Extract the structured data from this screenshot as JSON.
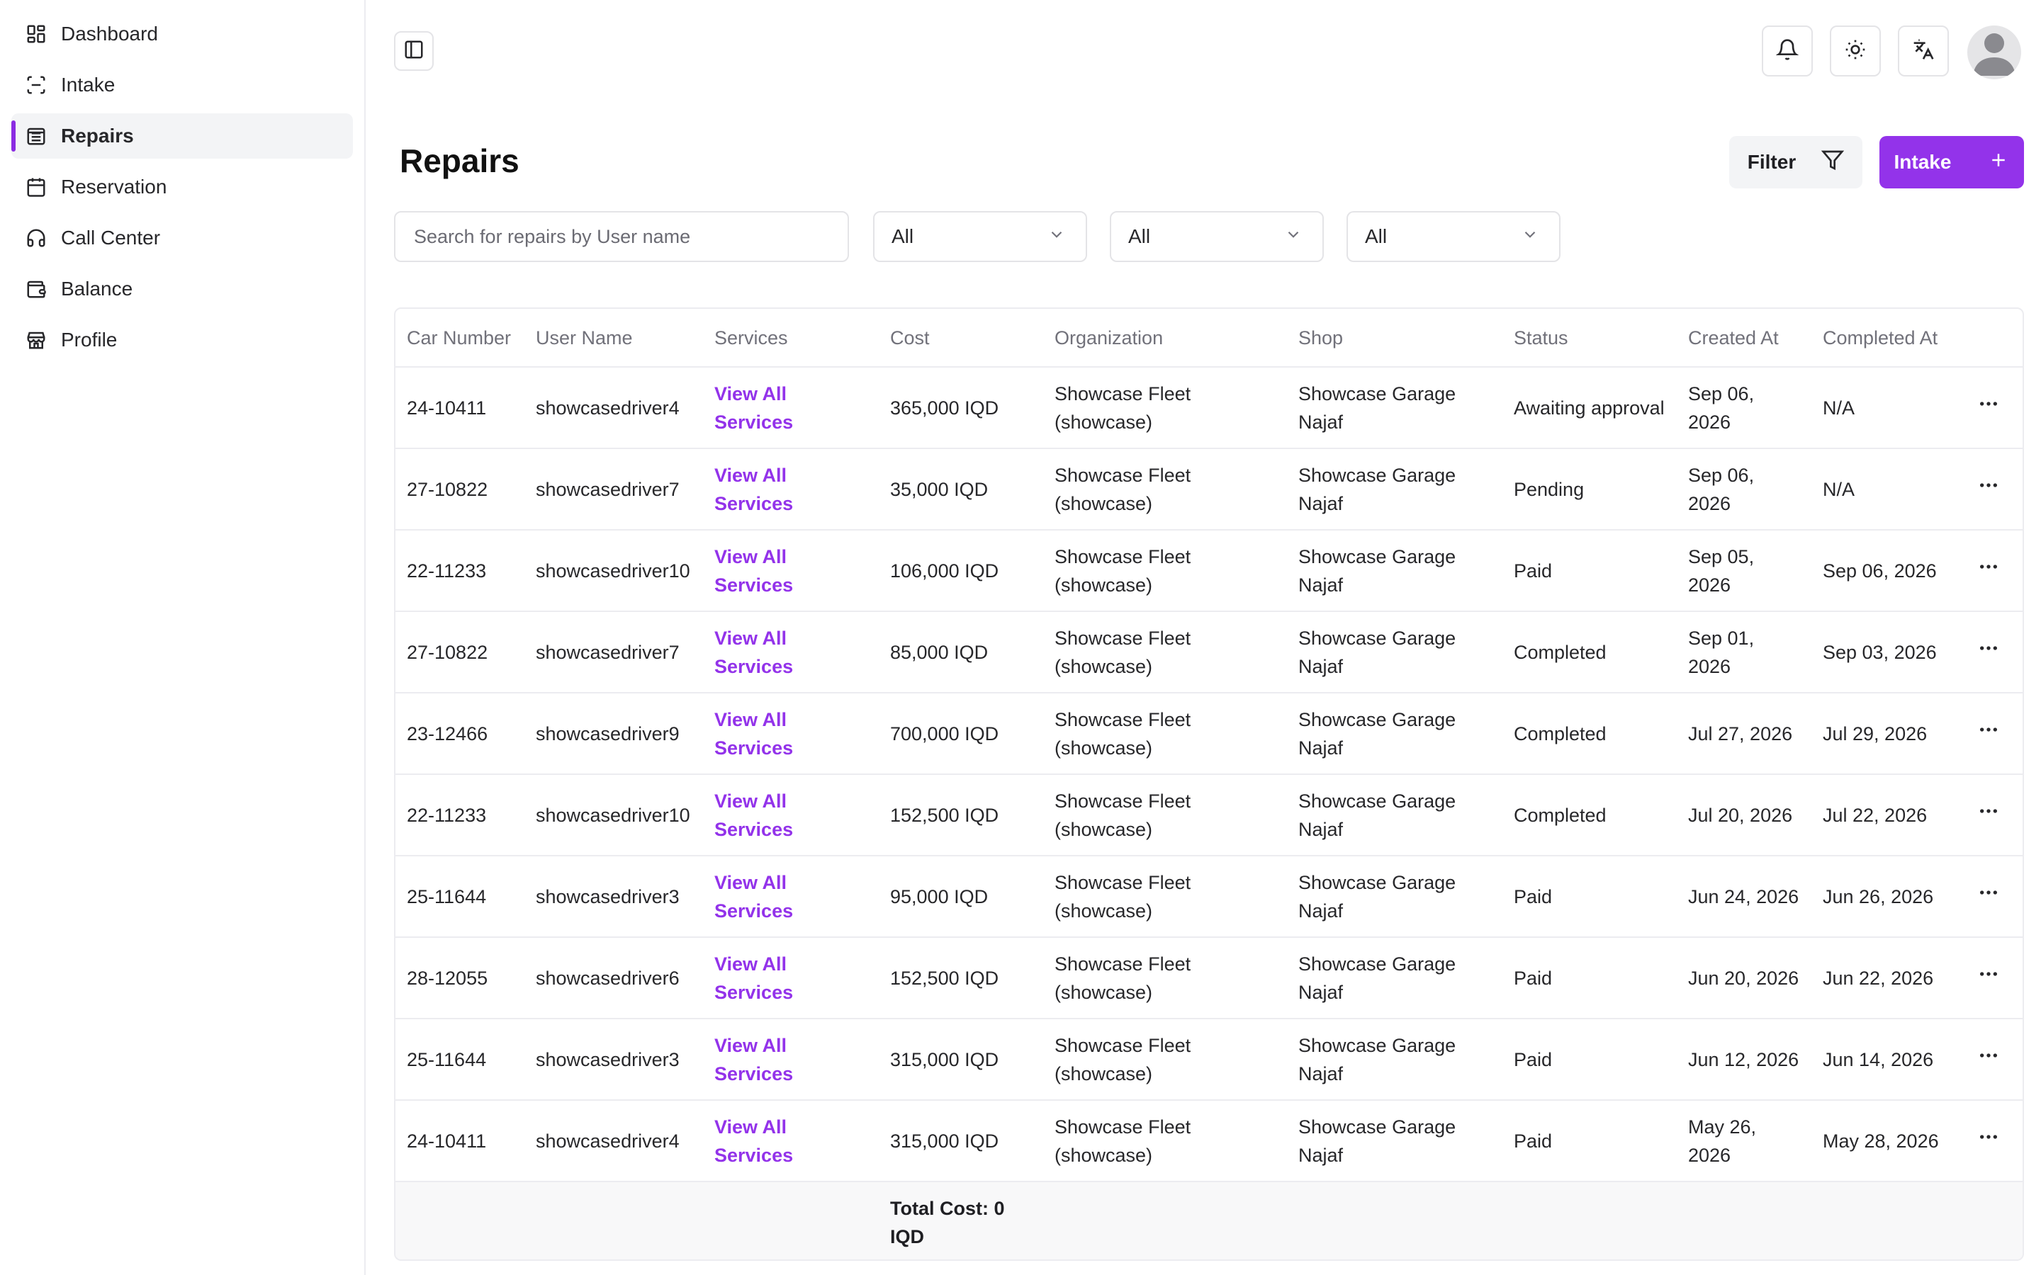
{
  "sidebar": {
    "items": [
      {
        "label": "Dashboard",
        "icon": "dashboard-grid-icon"
      },
      {
        "label": "Intake",
        "icon": "scan-icon"
      },
      {
        "label": "Repairs",
        "icon": "repairs-list-icon",
        "active": true
      },
      {
        "label": "Reservation",
        "icon": "calendar-icon"
      },
      {
        "label": "Call Center",
        "icon": "headset-icon"
      },
      {
        "label": "Balance",
        "icon": "wallet-icon"
      },
      {
        "label": "Profile",
        "icon": "store-icon"
      }
    ]
  },
  "header": {
    "icons": [
      "sidebar-toggle-icon",
      "bell-icon",
      "sun-icon",
      "translate-icon",
      "user-avatar-icon"
    ]
  },
  "page": {
    "title": "Repairs",
    "filter_label": "Filter",
    "intake_label": "Intake",
    "search_placeholder": "Search for repairs by User name",
    "selects": [
      "All",
      "All",
      "All"
    ]
  },
  "table": {
    "headers": [
      "Car Number",
      "User Name",
      "Services",
      "Cost",
      "Organization",
      "Shop",
      "Status",
      "Created At",
      "Completed At",
      ""
    ],
    "rows": [
      {
        "car": "24-10411",
        "user": "showcasedriver4",
        "services": "View All Services",
        "cost": "365,000 IQD",
        "org": "Showcase Fleet (showcase)",
        "shop": "Showcase Garage Najaf",
        "status": "Awaiting approval",
        "created": "Sep 06, 2026",
        "completed": "N/A"
      },
      {
        "car": "27-10822",
        "user": "showcasedriver7",
        "services": "View All Services",
        "cost": "35,000 IQD",
        "org": "Showcase Fleet (showcase)",
        "shop": "Showcase Garage Najaf",
        "status": "Pending",
        "created": "Sep 06, 2026",
        "completed": "N/A"
      },
      {
        "car": "22-11233",
        "user": "showcasedriver10",
        "services": "View All Services",
        "cost": "106,000 IQD",
        "org": "Showcase Fleet (showcase)",
        "shop": "Showcase Garage Najaf",
        "status": "Paid",
        "created": "Sep 05, 2026",
        "completed": "Sep 06, 2026"
      },
      {
        "car": "27-10822",
        "user": "showcasedriver7",
        "services": "View All Services",
        "cost": "85,000 IQD",
        "org": "Showcase Fleet (showcase)",
        "shop": "Showcase Garage Najaf",
        "status": "Completed",
        "created": "Sep 01, 2026",
        "completed": "Sep 03, 2026"
      },
      {
        "car": "23-12466",
        "user": "showcasedriver9",
        "services": "View All Services",
        "cost": "700,000 IQD",
        "org": "Showcase Fleet (showcase)",
        "shop": "Showcase Garage Najaf",
        "status": "Completed",
        "created": "Jul 27, 2026",
        "completed": "Jul 29, 2026"
      },
      {
        "car": "22-11233",
        "user": "showcasedriver10",
        "services": "View All Services",
        "cost": "152,500 IQD",
        "org": "Showcase Fleet (showcase)",
        "shop": "Showcase Garage Najaf",
        "status": "Completed",
        "created": "Jul 20, 2026",
        "completed": "Jul 22, 2026"
      },
      {
        "car": "25-11644",
        "user": "showcasedriver3",
        "services": "View All Services",
        "cost": "95,000 IQD",
        "org": "Showcase Fleet (showcase)",
        "shop": "Showcase Garage Najaf",
        "status": "Paid",
        "created": "Jun 24, 2026",
        "completed": "Jun 26, 2026"
      },
      {
        "car": "28-12055",
        "user": "showcasedriver6",
        "services": "View All Services",
        "cost": "152,500 IQD",
        "org": "Showcase Fleet (showcase)",
        "shop": "Showcase Garage Najaf",
        "status": "Paid",
        "created": "Jun 20, 2026",
        "completed": "Jun 22, 2026"
      },
      {
        "car": "25-11644",
        "user": "showcasedriver3",
        "services": "View All Services",
        "cost": "315,000 IQD",
        "org": "Showcase Fleet (showcase)",
        "shop": "Showcase Garage Najaf",
        "status": "Paid",
        "created": "Jun 12, 2026",
        "completed": "Jun 14, 2026"
      },
      {
        "car": "24-10411",
        "user": "showcasedriver4",
        "services": "View All Services",
        "cost": "315,000 IQD",
        "org": "Showcase Fleet (showcase)",
        "shop": "Showcase Garage Najaf",
        "status": "Paid",
        "created": "May 26, 2026",
        "completed": "May 28, 2026"
      }
    ],
    "total_label": "Total Cost: 0 IQD",
    "row_action_icon": "more-horizontal-icon"
  },
  "colors": {
    "accent": "#9333ea",
    "active_indicator": "#8b2be2",
    "muted_text": "#71717a",
    "border": "#ececf0"
  }
}
